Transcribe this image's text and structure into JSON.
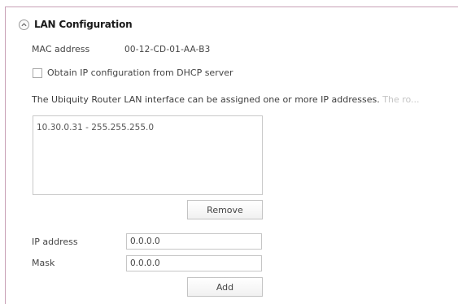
{
  "section": {
    "title": "LAN Configuration"
  },
  "mac": {
    "label": "MAC address",
    "value": "00-12-CD-01-AA-B3"
  },
  "dhcp": {
    "label": "Obtain IP configuration from DHCP server",
    "checked": false
  },
  "info_text": {
    "main": "The Ubiquity Router LAN interface can be assigned one or more IP addresses.",
    "faded": " The ro..."
  },
  "address_list": {
    "items": [
      "10.30.0.31 - 255.255.255.0"
    ]
  },
  "buttons": {
    "remove": "Remove",
    "add": "Add"
  },
  "ip_address": {
    "label": "IP address",
    "value": "0.0.0.0"
  },
  "mask": {
    "label": "Mask",
    "value": "0.0.0.0"
  },
  "colors": {
    "frame_border": "#c8a0b6"
  }
}
